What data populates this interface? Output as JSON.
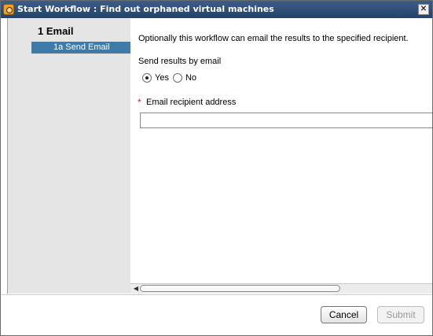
{
  "window": {
    "title": "Start Workflow : Find out orphaned virtual machines",
    "close_glyph": "✕"
  },
  "sidebar": {
    "step_title": "1 Email",
    "items": [
      {
        "label": "1a   Send Email",
        "selected": true
      }
    ]
  },
  "form": {
    "description": "Optionally this workflow can email the results to the specified recipient.",
    "send_results_label": "Send results by email",
    "radio_options": [
      {
        "label": "Yes",
        "checked": true
      },
      {
        "label": "No",
        "checked": false
      }
    ],
    "required_marker": "*",
    "email_label": "Email recipient address",
    "email_value": "",
    "email_placeholder": ""
  },
  "scrollbar": {
    "left_arrow": "◀"
  },
  "footer": {
    "cancel_label": "Cancel",
    "submit_label": "Submit",
    "submit_enabled": false
  },
  "colors": {
    "titlebar": "#2f4f7a",
    "selected_step": "#3e7ba8",
    "sidebar_bg": "#e5e5e5",
    "required_star": "#cc2222"
  },
  "icons": {
    "app": "workflow-app-icon",
    "close": "close-icon",
    "scroll_left": "scroll-left-arrow-icon"
  }
}
